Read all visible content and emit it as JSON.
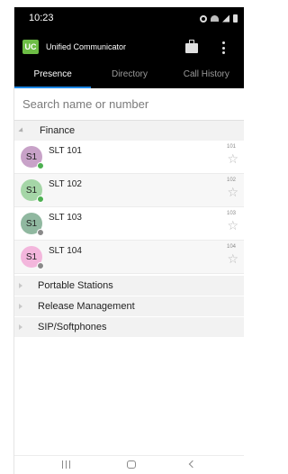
{
  "status_bar": {
    "time": "10:23"
  },
  "app_bar": {
    "logo": "UC",
    "title": "Unified Communicator"
  },
  "tabs": [
    {
      "label": "Presence",
      "active": true
    },
    {
      "label": "Directory",
      "active": false
    },
    {
      "label": "Call History",
      "active": false
    }
  ],
  "search": {
    "placeholder": "Search name or number",
    "value": ""
  },
  "groups": {
    "finance": {
      "label": "Finance",
      "expanded": true
    },
    "portable": {
      "label": "Portable Stations",
      "expanded": false
    },
    "release": {
      "label": "Release Management",
      "expanded": false
    },
    "sip": {
      "label": "SIP/Softphones",
      "expanded": false
    }
  },
  "contacts": [
    {
      "initials": "S1",
      "name": "SLT 101",
      "number": "101",
      "avatar_color": "#c8a2c8",
      "presence_color": "#4caf50"
    },
    {
      "initials": "S1",
      "name": "SLT 102",
      "number": "102",
      "avatar_color": "#a5d6a7",
      "presence_color": "#4caf50"
    },
    {
      "initials": "S1",
      "name": "SLT 103",
      "number": "103",
      "avatar_color": "#90b8a0",
      "presence_color": "#8a8a8a"
    },
    {
      "initials": "S1",
      "name": "SLT 104",
      "number": "104",
      "avatar_color": "#f3b6dc",
      "presence_color": "#8a8a8a"
    }
  ],
  "icons": {
    "star": "star-icon",
    "more": "more-vert-icon",
    "briefcase": "briefcase-icon"
  },
  "colors": {
    "accent": "#1e88e5",
    "brand": "#6dbd45",
    "appbar": "#000000"
  }
}
